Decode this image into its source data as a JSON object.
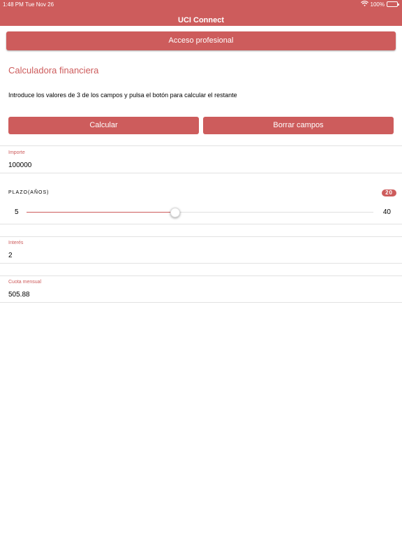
{
  "status_bar": {
    "time": "1:48 PM",
    "date": "Tue Nov 26",
    "battery": "100%"
  },
  "app": {
    "title": "UCI Connect"
  },
  "pro_button": {
    "label": "Acceso profesional"
  },
  "calculator": {
    "title": "Calculadora financiera",
    "instructions": "Introduce los valores de 3 de los campos y pulsa el botón para calcular el restante",
    "calc_label": "Calcular",
    "clear_label": "Borrar campos"
  },
  "fields": {
    "importe": {
      "label": "Importe",
      "value": "100000"
    },
    "plazo": {
      "label": "PLAZO(AÑOS)",
      "value": 20,
      "badge": "20",
      "min": 5,
      "max": 40,
      "min_label": "5",
      "max_label": "40"
    },
    "interes": {
      "label": "Interés",
      "value": "2"
    },
    "cuota": {
      "label": "Cuota mensual",
      "value": "505.88"
    }
  },
  "colors": {
    "accent": "#cd5c5c"
  },
  "icons": {
    "wifi": "wifi-icon",
    "battery": "battery-icon"
  }
}
